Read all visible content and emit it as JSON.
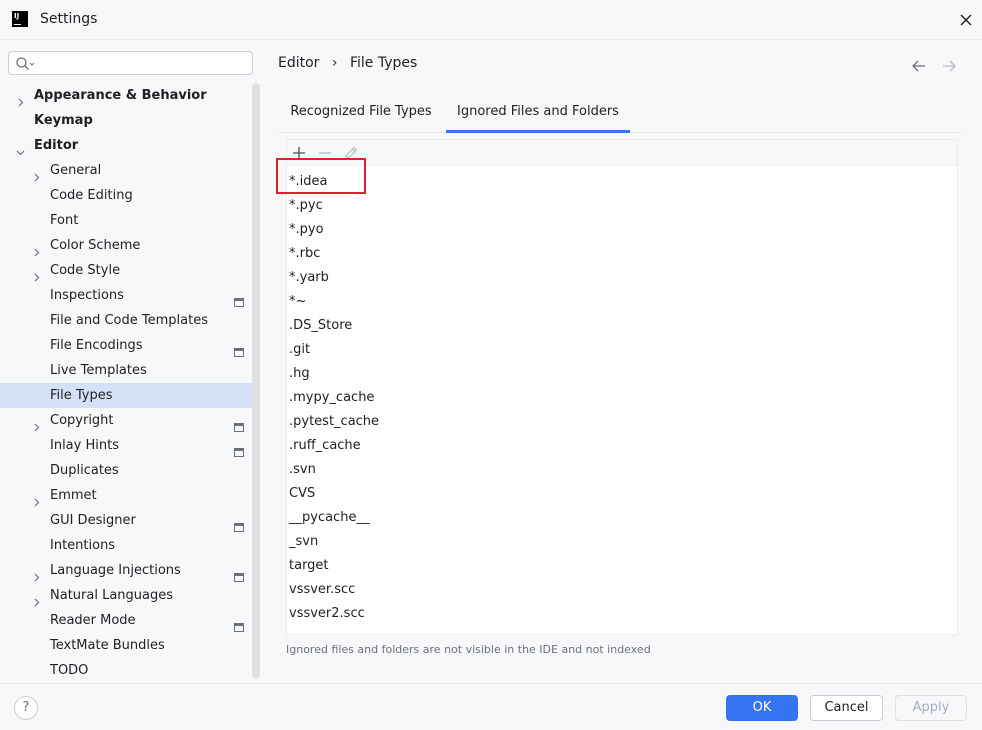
{
  "window": {
    "title": "Settings"
  },
  "search": {
    "placeholder": "",
    "value": ""
  },
  "sidebar": {
    "items": [
      {
        "label": "Appearance & Behavior",
        "level": 0,
        "expandable": true,
        "expanded": false,
        "bold": true
      },
      {
        "label": "Keymap",
        "level": 0,
        "expandable": false,
        "bold": true
      },
      {
        "label": "Editor",
        "level": 0,
        "expandable": true,
        "expanded": true,
        "bold": true
      },
      {
        "label": "General",
        "level": 1,
        "expandable": true
      },
      {
        "label": "Code Editing",
        "level": 1
      },
      {
        "label": "Font",
        "level": 1
      },
      {
        "label": "Color Scheme",
        "level": 1,
        "expandable": true
      },
      {
        "label": "Code Style",
        "level": 1,
        "expandable": true
      },
      {
        "label": "Inspections",
        "level": 1,
        "project": true
      },
      {
        "label": "File and Code Templates",
        "level": 1
      },
      {
        "label": "File Encodings",
        "level": 1,
        "project": true
      },
      {
        "label": "Live Templates",
        "level": 1
      },
      {
        "label": "File Types",
        "level": 1,
        "selected": true
      },
      {
        "label": "Copyright",
        "level": 1,
        "expandable": true,
        "project": true
      },
      {
        "label": "Inlay Hints",
        "level": 1,
        "project": true
      },
      {
        "label": "Duplicates",
        "level": 1
      },
      {
        "label": "Emmet",
        "level": 1,
        "expandable": true
      },
      {
        "label": "GUI Designer",
        "level": 1,
        "project": true
      },
      {
        "label": "Intentions",
        "level": 1
      },
      {
        "label": "Language Injections",
        "level": 1,
        "expandable": true,
        "project": true
      },
      {
        "label": "Natural Languages",
        "level": 1,
        "expandable": true
      },
      {
        "label": "Reader Mode",
        "level": 1,
        "project": true
      },
      {
        "label": "TextMate Bundles",
        "level": 1
      },
      {
        "label": "TODO",
        "level": 1
      }
    ]
  },
  "breadcrumb": {
    "parent": "Editor",
    "separator": "›",
    "current": "File Types"
  },
  "tabs": [
    {
      "label": "Recognized File Types",
      "active": false
    },
    {
      "label": "Ignored Files and Folders",
      "active": true
    }
  ],
  "ignored": {
    "items": [
      "*.idea",
      "*.pyc",
      "*.pyo",
      "*.rbc",
      "*.yarb",
      "*~",
      ".DS_Store",
      ".git",
      ".hg",
      ".mypy_cache",
      ".pytest_cache",
      ".ruff_cache",
      ".svn",
      "CVS",
      "__pycache__",
      "_svn",
      "target",
      "vssver.scc",
      "vssver2.scc"
    ],
    "hint": "Ignored files and folders are not visible in the IDE and not indexed"
  },
  "footer": {
    "help": "?",
    "ok": "OK",
    "cancel": "Cancel",
    "apply": "Apply"
  },
  "colors": {
    "accent": "#3574f0",
    "selection": "#d5e1f7",
    "highlight": "#e0202a"
  },
  "icons": [
    "app-icon",
    "close-icon",
    "search-icon",
    "chevron-right-icon",
    "chevron-down-icon",
    "project-scope-icon",
    "back-arrow-icon",
    "forward-arrow-icon",
    "add-icon",
    "remove-icon",
    "edit-icon",
    "help-icon"
  ]
}
